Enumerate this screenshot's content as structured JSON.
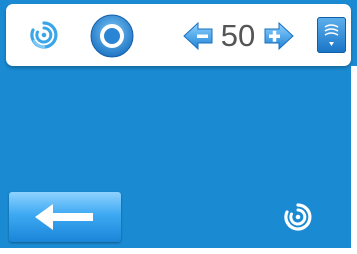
{
  "header": {
    "mode_icon": "swirl-icon",
    "power_icon": "power-button-icon",
    "value_display": "50",
    "decrease_icon": "arrow-left-minus-icon",
    "increase_icon": "arrow-right-plus-icon",
    "fan_icon": "fan-speed-icon"
  },
  "footer": {
    "back_icon": "back-arrow-icon",
    "mode_icon": "swirl-icon"
  },
  "colors": {
    "background": "#1a8ad2",
    "panel": "#ffffff",
    "accent": "#1e7fd0",
    "value_text": "#555555"
  }
}
